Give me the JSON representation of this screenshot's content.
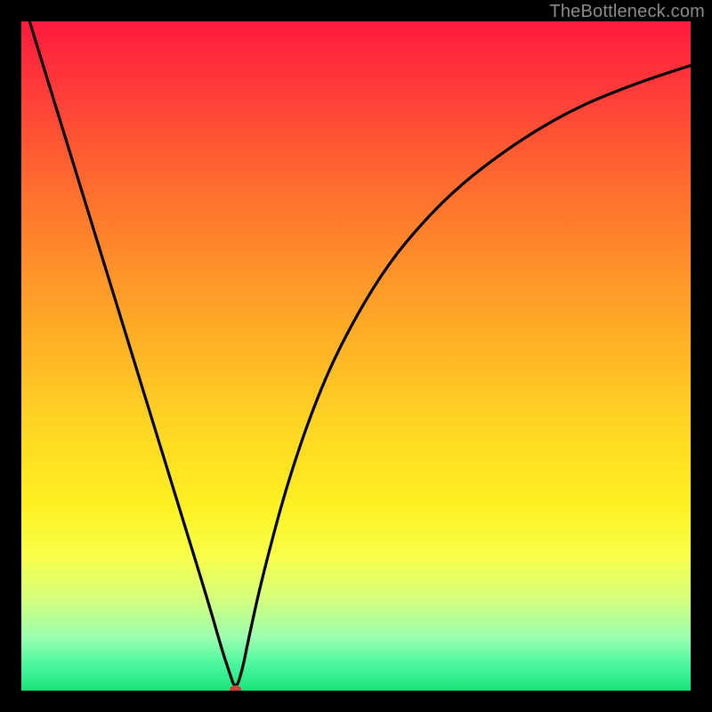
{
  "watermark": "TheBottleneck.com",
  "chart_data": {
    "type": "line",
    "title": "",
    "xlabel": "",
    "ylabel": "",
    "xlim": [
      0,
      100
    ],
    "ylim": [
      0,
      100
    ],
    "background_gradient": {
      "top_color": "#ff1a3c",
      "bottom_color": "#18e47a",
      "meaning": "red = high bottleneck, green = low bottleneck"
    },
    "minimum_point": {
      "x": 32,
      "y": 0
    },
    "series": [
      {
        "name": "bottleneck-curve",
        "x": [
          0,
          4,
          8,
          12,
          16,
          20,
          24,
          28,
          30,
          31,
          32,
          33,
          34,
          36,
          40,
          45,
          50,
          55,
          60,
          65,
          70,
          75,
          80,
          85,
          90,
          95,
          100
        ],
        "y": [
          104,
          91,
          78,
          65,
          52,
          39,
          26,
          13,
          6,
          3,
          0,
          3,
          8,
          17,
          32,
          46,
          56,
          64,
          70,
          75,
          79,
          82.5,
          85.5,
          88,
          90,
          91.8,
          93.4
        ]
      }
    ],
    "marker": {
      "x": 32,
      "y": 0,
      "color": "#d0433a"
    }
  }
}
